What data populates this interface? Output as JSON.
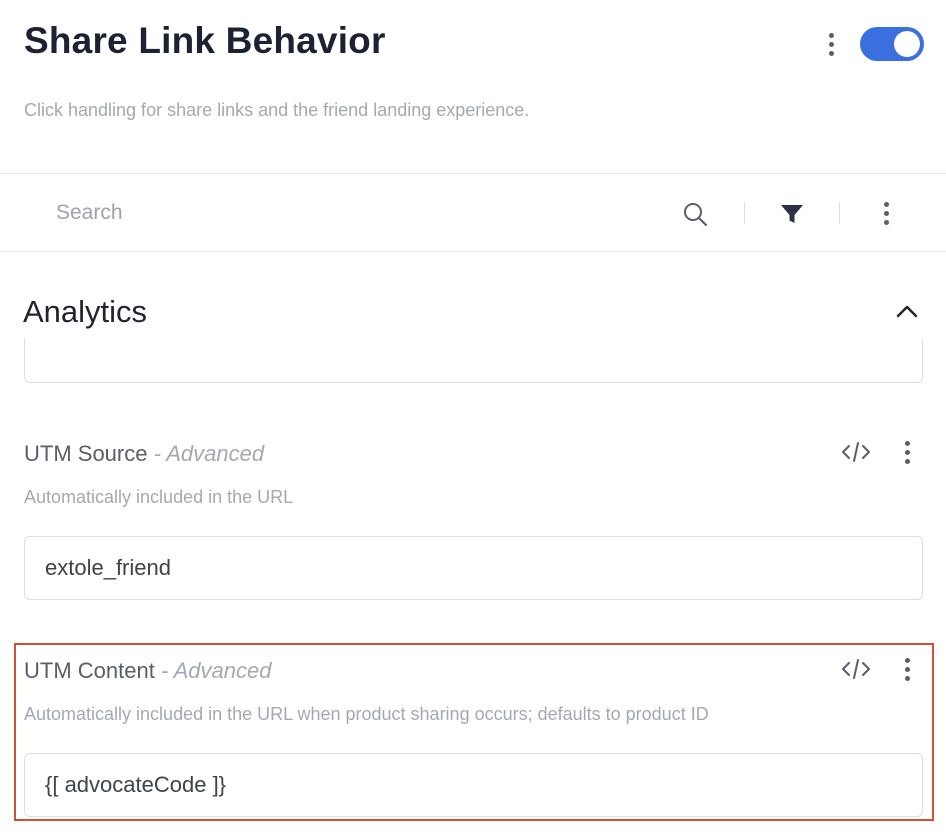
{
  "header": {
    "title": "Share Link Behavior",
    "subtitle": "Click handling for share links and the friend landing experience.",
    "toggle_on": true,
    "toggle_color": "#3b6fe0"
  },
  "search": {
    "placeholder": "Search",
    "icons": [
      "search-icon",
      "filter-icon",
      "kebab-icon"
    ]
  },
  "section": {
    "title": "Analytics",
    "expanded": true,
    "icon": "chevron-up-icon"
  },
  "fields": [
    {
      "label": "UTM Source",
      "advanced_tag": "- Advanced",
      "description": "Automatically included in the URL",
      "value": "extole_friend",
      "icons": [
        "code-icon",
        "kebab-icon"
      ],
      "highlighted": false
    },
    {
      "label": "UTM Content",
      "advanced_tag": "- Advanced",
      "description": "Automatically included in the URL when product sharing occurs; defaults to product ID",
      "value": "{[ advocateCode ]}",
      "icons": [
        "code-icon",
        "kebab-icon"
      ],
      "highlighted": true,
      "highlight_color": "#d94c35"
    }
  ]
}
